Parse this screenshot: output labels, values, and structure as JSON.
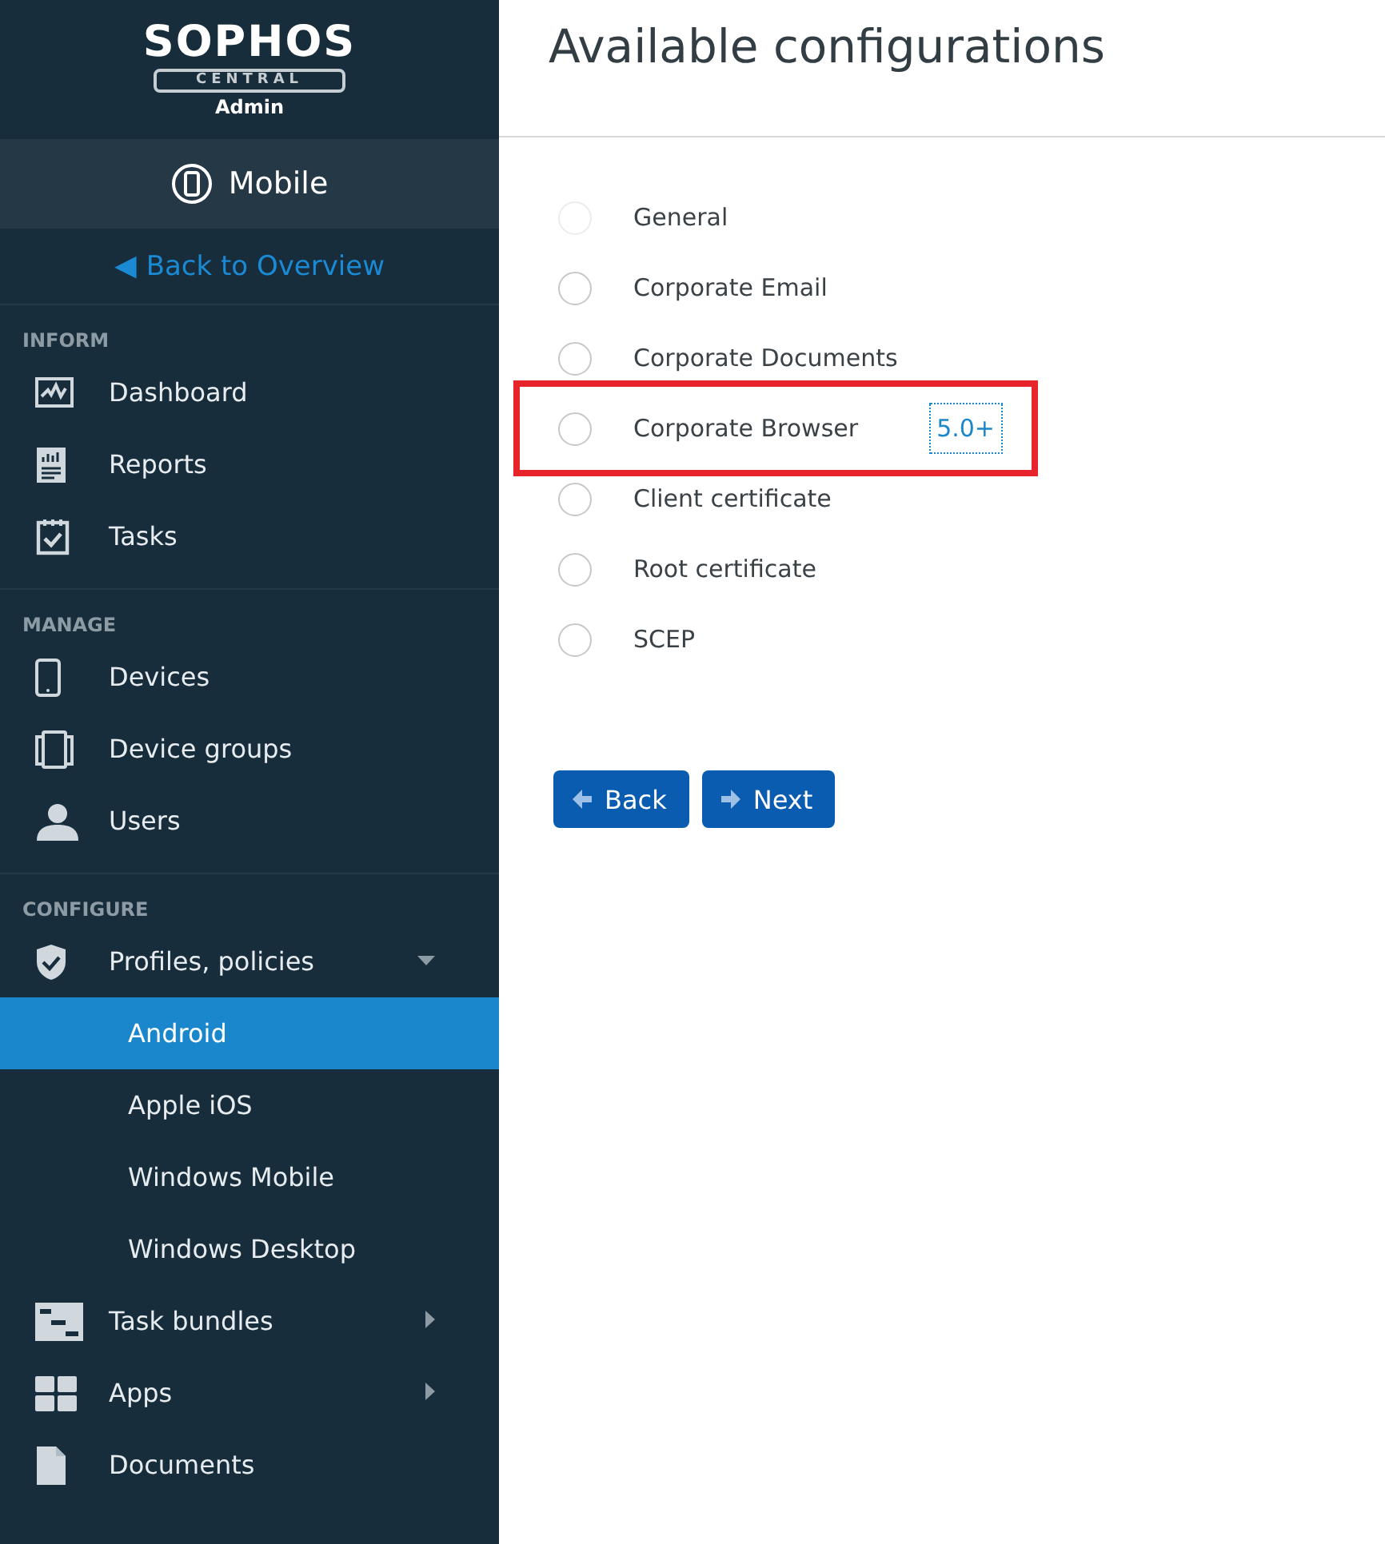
{
  "sidebar": {
    "logo": {
      "brand": "SOPHOS",
      "product": "CENTRAL",
      "role": "Admin"
    },
    "module": {
      "label": "Mobile"
    },
    "back_link": {
      "icon": "◀",
      "label": "Back to Overview"
    },
    "sections": [
      {
        "heading": "INFORM",
        "items": [
          {
            "label": "Dashboard"
          },
          {
            "label": "Reports"
          },
          {
            "label": "Tasks"
          }
        ]
      },
      {
        "heading": "MANAGE",
        "items": [
          {
            "label": "Devices"
          },
          {
            "label": "Device groups"
          },
          {
            "label": "Users"
          }
        ]
      },
      {
        "heading": "CONFIGURE",
        "items": [
          {
            "label": "Profiles, policies",
            "expanded": true,
            "children": [
              {
                "label": "Android",
                "selected": true
              },
              {
                "label": "Apple iOS",
                "selected": false
              },
              {
                "label": "Windows Mobile",
                "selected": false
              },
              {
                "label": "Windows Desktop",
                "selected": false
              }
            ]
          },
          {
            "label": "Task bundles",
            "expanded": false
          },
          {
            "label": "Apps",
            "expanded": false
          },
          {
            "label": "Documents"
          }
        ]
      }
    ]
  },
  "main": {
    "title": "Available configurations",
    "options": [
      {
        "label": "General",
        "selected": false,
        "disabled": true,
        "highlighted": false
      },
      {
        "label": "Corporate Email",
        "selected": false,
        "disabled": false,
        "highlighted": false
      },
      {
        "label": "Corporate Documents",
        "selected": false,
        "disabled": false,
        "highlighted": false
      },
      {
        "label": "Corporate Browser",
        "selected": false,
        "disabled": false,
        "highlighted": true,
        "badge": "5.0+"
      },
      {
        "label": "Client certificate",
        "selected": false,
        "disabled": false,
        "highlighted": false
      },
      {
        "label": "Root certificate",
        "selected": false,
        "disabled": false,
        "highlighted": false
      },
      {
        "label": "SCEP",
        "selected": false,
        "disabled": false,
        "highlighted": false
      }
    ],
    "buttons": [
      {
        "kind": "back",
        "label": "Back"
      },
      {
        "kind": "next",
        "label": "Next"
      }
    ]
  }
}
